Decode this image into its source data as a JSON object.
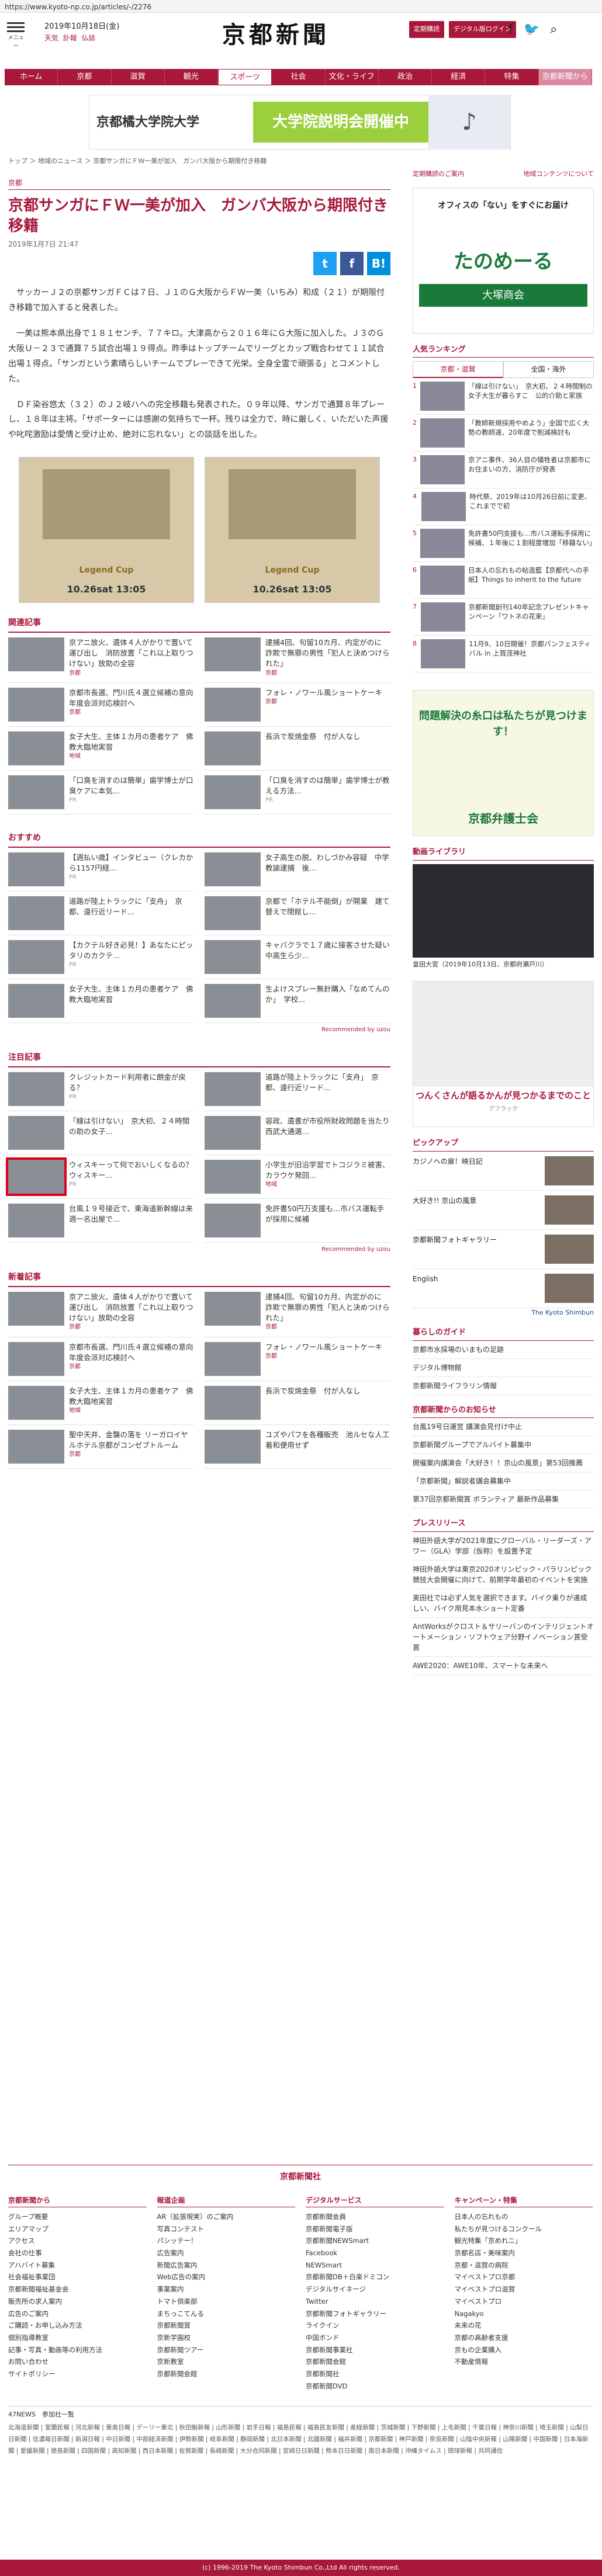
{
  "url": "https://www.kyoto-np.co.jp/articles/-/2276",
  "header": {
    "menu_label": "メニュー",
    "date": "2019年10月18日(金)",
    "weather": "天気",
    "obits": "訃報",
    "kanji": "仏誌",
    "logo": "京都新聞",
    "btn_subscribe": "定期購読",
    "btn_digital": "デジタル版ログイン",
    "social_f": "f",
    "social_tw": "🐦"
  },
  "nav": [
    "ホーム",
    "京都",
    "滋賀",
    "観光",
    "スポーツ",
    "社会",
    "文化・ライフ",
    "政治",
    "経済",
    "特集",
    "京都新聞から"
  ],
  "banner": {
    "left": "京都橘大学院大学",
    "mid": "大学院説明会開催中"
  },
  "breadcrumb": "トップ ＞ 地域のニュース ＞ 京都サンガにＦＷ一美が加入　ガンバ大阪から期限付き移籍",
  "article": {
    "section": "京都",
    "title": "京都サンガにＦＷ一美が加入　ガンバ大阪から期限付き移籍",
    "date": "2019年1月7日 21:47",
    "p1": "サッカーＪ２の京都サンガＦＣは７日、Ｊ１のＧ大阪からＦＷ一美（いちみ）和成（２１）が期限付き移籍で加入すると発表した。",
    "p2": "一美は熊本県出身で１８１センチ、７７キロ。大津高から２０１６年にＧ大阪に加入した。Ｊ３のＧ大阪Ｕ－２３で通算７５試合出場１９得点。昨季はトップチームでリーグとカップ戦合わせて１１試合出場１得点。「サンガという素晴らしいチームでプレーできて光栄。全身全霊で頑張る」とコメントした。",
    "p3": "ＤＦ染谷悠太（３２）のＪ２岐ハへの完全移籍も発表された。０９年以降、サンガで通算８年プレーし、１８年は主将。「サポーターには感謝の気持ちで一杯。残りは全力で、時に厳しく、いただいた声援や叱咤激励は愛情と受け止め、絶対に忘れない」との談話を出した。"
  },
  "ads": [
    {
      "title": "Legend Cup",
      "date": "10.26sat 13:05"
    },
    {
      "title": "Legend Cup",
      "date": "10.26sat 13:05"
    }
  ],
  "related": {
    "title": "関連記事",
    "items": [
      {
        "text": "京アニ放火、遺体４人がかりで置いて運び出し　消防放置「これ以上取りつけない」放助の全容",
        "src": "京都"
      },
      {
        "text": "逮捕4回、句留10カ月、内定がのに　詐欺で無罪の男性「犯人と決めつけられた」",
        "src": "京都"
      },
      {
        "text": "京都市長選、門川氏４選立候補の意向　年度会派対応検討へ",
        "src": "京都"
      },
      {
        "text": "フォレ・ノワール風ショートケーキ",
        "src": "京都"
      },
      {
        "text": "女子大生、主体１カ月の患者ケア　佛教大臨地実習",
        "src": "地域"
      },
      {
        "text": "長浜で炭焼金祭　付が人なし",
        "src": ""
      },
      {
        "text": "「口臭を消すのは簡単」歯学博士が口臭ケアに本気...",
        "src": "PR"
      },
      {
        "text": "「口臭を消すのは簡単」歯学博士が教える方法...",
        "src": "PR"
      }
    ]
  },
  "recommend": {
    "title": "おすすめ",
    "items": [
      {
        "text": "【週払い歳】インタビュー（クレカから1157円経...",
        "src": "PR"
      },
      {
        "text": "女子高生の脱、わしづかみ容疑　中学教諭逮捕　後...",
        "src": ""
      },
      {
        "text": "道路が陸上トラックに「支舟」　京都、遠行近リード...",
        "src": ""
      },
      {
        "text": "京都で「ホテル不能倒」が開業　建て替えで閉館し...",
        "src": ""
      },
      {
        "text": "【カクテル好き必見！】あなたにピッタリのカクテ...",
        "src": "PR"
      },
      {
        "text": "キャバクラで１７歳に接客させた疑い　中高生ら少...",
        "src": ""
      },
      {
        "text": "女子大生、主体１カ月の患者ケア　佛教大臨地実習",
        "src": ""
      },
      {
        "text": "生よけスプレー無針購入「なめてんのか」　学校...",
        "src": ""
      }
    ],
    "recommended_by": "Recommended by uzou"
  },
  "attention": {
    "title": "注目記事",
    "items": [
      {
        "text": "クレジットカード利用者に朗金が戻る？",
        "src": "PR"
      },
      {
        "text": "道路が陸上トラックに「支舟」　京都、遠行近リード...",
        "src": ""
      },
      {
        "text": "「線は引けない」　京大初、２４時間の助の女子...",
        "src": ""
      },
      {
        "text": "容政、遺書が市役所財政問題を当たり　西武大通選...",
        "src": ""
      },
      {
        "text": "ウィスキーって何でおいしくなるの？ウィスキー...",
        "src": "PR"
      },
      {
        "text": "小学生が旧沿学習でトコジラミ被害、カラウケ発回...",
        "src": "地域"
      },
      {
        "text": "台風１９号接近で、東海道新幹線は来週一名出屋で...",
        "src": ""
      },
      {
        "text": "免許書50円万支援も…市バス運転手が採用に候補",
        "src": ""
      }
    ],
    "recommended_by": "Recommended by uzou"
  },
  "latest": {
    "title": "新着記事",
    "items": [
      {
        "text": "京アニ放火、遺体４人がかりで置いて運び出し　消防放置「これ以上取りつけない」放助の全容",
        "src": "京都"
      },
      {
        "text": "逮捕4回、句留10カ月、内定がのに　詐欺で無罪の男性「犯人と決めつけられた」",
        "src": "京都"
      },
      {
        "text": "京都市長選、門川氏４選立候補の意向　年度会派対応検討へ",
        "src": "京都"
      },
      {
        "text": "フォレ・ノワール風ショートケーキ",
        "src": "京都"
      },
      {
        "text": "女子大生、主体１カ月の患者ケア　佛教大臨地実習",
        "src": "地域"
      },
      {
        "text": "長浜で炭焼金祭　付が人なし",
        "src": ""
      },
      {
        "text": "聖中天井、金襲の落を リーガロイヤルホテル京都がコンゼプトルーム",
        "src": "京都"
      },
      {
        "text": "ユズやパフを各種販売　池ルセな人工着和便用せず",
        "src": ""
      }
    ]
  },
  "side": {
    "subscribe_link": "定期購読のご案内",
    "digital_link": "地域コンテンツについて",
    "ad1_text": "オフィスの「ない」をすぐにお届け",
    "ad1_brand": "たのめーる",
    "ad1_company": "大塚商会",
    "ranking_title": "人気ランキング",
    "ranking_tabs": [
      "京都・滋賀",
      "全国・海外"
    ],
    "ranking": [
      {
        "n": "1",
        "t": "「線は引けない」　京大初、２４時間制の女子大生が暮らすこ　公的介助と家族"
      },
      {
        "n": "2",
        "t": "「教師新規採用やめよう」全国で広く大勢の教師達、20年度で削減検討も"
      },
      {
        "n": "3",
        "t": "京アニ事件、36人目の犠牲者は京都市にお住まいの方、消防庁が発表"
      },
      {
        "n": "4",
        "t": "時代祭、2019年は10月26日前に変更、これまでで初"
      },
      {
        "n": "5",
        "t": "免許書50円支援も…市バス運転手採用に候補、１年後に１割程度増加「移籍ない」"
      },
      {
        "n": "6",
        "t": "日本人の忘れもの帖造藍【京都代への手紙】Things to inherit to the future"
      },
      {
        "n": "7",
        "t": "京都新聞創刊140年記念プレゼントキャンペーン「ワトネの花束」"
      },
      {
        "n": "8",
        "t": "11月9、10日開催！京都パンフェスティバル in 上賀茂神社"
      }
    ],
    "ad2_text": "問題解決の糸口は私たちが見つけます！",
    "ad2_org": "京都弁護士会",
    "video_title": "動画ライブラリ",
    "video_caption": "皇田大宮（2019年10月13日、京都府瀬戸川）",
    "ad3_text": "つんくさんが語るかんが見つかるまでのこと",
    "ad3_src": "アフラック",
    "pickup_title": "ピックアップ",
    "pickup": [
      "カジノへの扉！映日記",
      "大好き!! 京山の風景",
      "京都新聞フォトギャラリー",
      "English"
    ],
    "kyoto_shimbun_en": "The Kyoto Shimbun",
    "guide_title": "暮らしのガイド",
    "guide": [
      "京都市水採場のいまもの足跡",
      "デジタル博物館",
      "京都新聞ライフラリン情報"
    ],
    "notice_title": "京都新聞からのお知らせ",
    "notices": [
      "台風19号日運営 講演会見付け中止",
      "京都新聞グループでアルバイト募集中",
      "開催案内講演会「大好き！！京山の風景」第53回推薦",
      "「京都新聞」解説者講会募集中",
      "第37回京都新聞賞 ボランティア 最新作品募集"
    ],
    "press_title": "プレスリリース",
    "press": [
      "神田外語大学が2021年度にグローバル・リーダーズ・アワー（GLA）学部（仮称）を設置予定",
      "神田外語大学は東京2020オリンピック・パラリンピック競技大会開催に向けて、前期学年最初のイベントを実施",
      "奥田社では必ず人気を選択できます。バイク乗りが達成しい、バイク用見本水ショート定番",
      "AntWorksがクロスト＆サリーバンのインテリジェントオートメーション・ソフトウェア分野イノベーション賞受賞",
      "AWE2020：AWE10年、スマートな未来へ"
    ]
  },
  "footer": {
    "logo": "京都新聞社",
    "cols": [
      {
        "h": "京都新聞から",
        "items": [
          "グループ概要",
          "エリアマップ",
          "アクセス",
          "会社の仕事",
          "アハバイト募集",
          "社会福祉事業団",
          "京都新聞福祉基金会",
          "販売所の求人案内",
          "広告のご案内",
          "ご購読・お申し込み方法",
          "個別指導教室",
          "記事・写真・動画等の利用方法",
          "お問い合わせ",
          "サイトポリシー"
        ]
      },
      {
        "h": "報道企画",
        "items": [
          "AR（拡張現実）のご案内",
          "写真コンテスト",
          "パシッテー！",
          "広告案内",
          "新聞広告案内",
          "Web広告の案内",
          "事業案内",
          "トマト倶楽部",
          "まちっこてんる",
          "京都新聞賞",
          "京新学園校",
          "京都新聞ツアー",
          "京新教室",
          "京都新聞会館"
        ]
      },
      {
        "h": "デジタルサービス",
        "items": [
          "京都新聞会員",
          "京都新聞電子版",
          "京都新聞NEWSmart",
          "Facebook",
          "NEWSmart",
          "京都新聞DB＋白楽ドミコン",
          "デジタルサイネージ",
          "Twitter",
          "京都新聞フォトギャラリー",
          "ライクイン",
          "中国ボンド",
          "京都新聞事業社",
          "京都新聞会館",
          "京都新聞社",
          "京都新聞DVD"
        ]
      },
      {
        "h": "キャンペーン・特集",
        "items": [
          "日本人の忘れもの",
          "私たちが見つけるコンクール",
          "観光特集「京めれニ」",
          "京都名店・美味案内",
          "京都・滋賀の病院",
          "マイベストプロ京都",
          "マイベストプロ滋賀",
          "マイベストプロ",
          "Nagakyo",
          "未来の花",
          "京都の高齢者支援",
          "京もの企業購入",
          "不動産情報"
        ]
      }
    ],
    "n47": "47NEWS　参加社一覧",
    "n47_links": "北海道新聞 | 室蘭民報 | 河北新報 | 東奥日報 | デーリー東北 | 秋田魁新報 | 山形新聞 | 岩手日報 | 福島民報 | 福島民友新聞 | 産経新聞 | 茨城新聞 | 下野新聞 | 上毛新聞 | 千葉日報 | 神奈川新聞 | 埼玉新聞 | 山梨日日新聞 | 信濃毎日新聞 | 新潟日報 | 中日新聞 | 中部経済新聞 | 伊勢新聞 | 岐阜新聞 | 静岡新聞 | 北日本新聞 | 北國新聞 | 福井新聞 | 京都新聞 | 神戸新聞 | 奈良新聞 | 山陰中央新報 | 山陽新聞 | 中国新聞 | 日本海新聞 | 愛媛新聞 | 徳島新聞 | 四国新聞 | 高知新聞 | 西日本新聞 | 佐賀新聞 | 長崎新聞 | 大分合同新聞 | 宮崎日日新聞 | 熊本日日新聞 | 南日本新聞 | 沖縄タイムス | 琉球新報 | 共同通信",
    "copyright": "(c) 1996-2019 The Kyoto Shimbun Co.,Ltd All rights reserved."
  },
  "colors": {
    "accent": "#a8183a",
    "twitter": "#1da1f2",
    "facebook": "#3b5998",
    "hatena": "#008fde"
  }
}
